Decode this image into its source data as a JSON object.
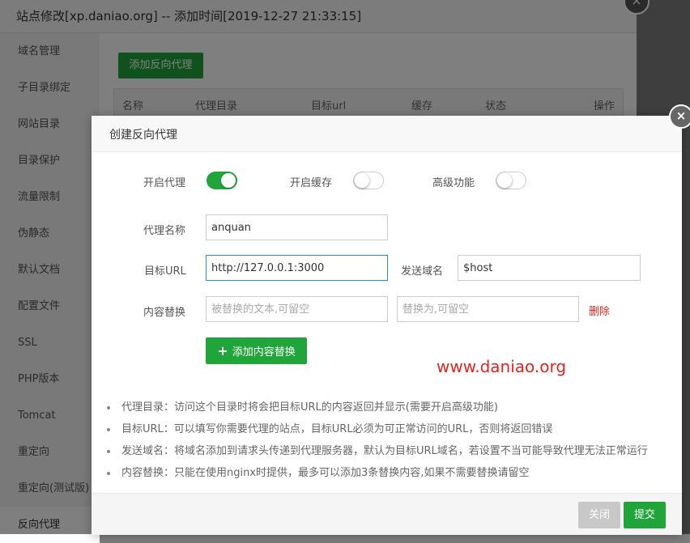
{
  "window": {
    "title": "站点修改[xp.daniao.org] -- 添加时间[2019-12-27 21:33:15]",
    "close_glyph": "×"
  },
  "sidebar": {
    "items": [
      {
        "label": "域名管理"
      },
      {
        "label": "子目录绑定"
      },
      {
        "label": "网站目录"
      },
      {
        "label": "目录保护"
      },
      {
        "label": "流量限制"
      },
      {
        "label": "伪静态"
      },
      {
        "label": "默认文档"
      },
      {
        "label": "配置文件"
      },
      {
        "label": "SSL"
      },
      {
        "label": "PHP版本"
      },
      {
        "label": "Tomcat"
      },
      {
        "label": "重定向"
      },
      {
        "label": "重定向(测试版)"
      },
      {
        "label": "反向代理"
      }
    ],
    "active_index": 13
  },
  "main": {
    "add_proxy_label": "添加反向代理",
    "table_headers": [
      "名称",
      "代理目录",
      "目标url",
      "缓存",
      "状态",
      "操作"
    ]
  },
  "modal": {
    "title": "创建反向代理",
    "close_glyph": "×",
    "toggles": [
      {
        "label": "开启代理",
        "on": true
      },
      {
        "label": "开启缓存",
        "on": false
      },
      {
        "label": "高级功能",
        "on": false
      }
    ],
    "proxy_name": {
      "label": "代理名称",
      "value": "anquan"
    },
    "target_url": {
      "label": "目标URL",
      "value": "http://127.0.0.1:3000"
    },
    "send_domain": {
      "label": "发送域名",
      "value": "$host"
    },
    "content_replace": {
      "label": "内容替换",
      "from_placeholder": "被替换的文本,可留空",
      "to_placeholder": "替换为,可留空",
      "delete_label": "删除"
    },
    "add_replace_label": "添加内容替换",
    "watermark": "www.daniao.org",
    "tips": [
      "代理目录：访问这个目录时将会把目标URL的内容返回并显示(需要开启高级功能)",
      "目标URL：可以填写你需要代理的站点，目标URL必须为可正常访问的URL，否则将返回错误",
      "发送域名：将域名添加到请求头传递到代理服务器，默认为目标URL域名，若设置不当可能导致代理无法正常运行",
      "内容替换：只能在使用nginx时提供，最多可以添加3条替换内容,如果不需要替换请留空"
    ],
    "close_label": "关闭",
    "submit_label": "提交"
  },
  "colors": {
    "accent_green": "#20a53a",
    "danger_red": "#e0261f",
    "focus_blue": "#2b8ed9"
  }
}
